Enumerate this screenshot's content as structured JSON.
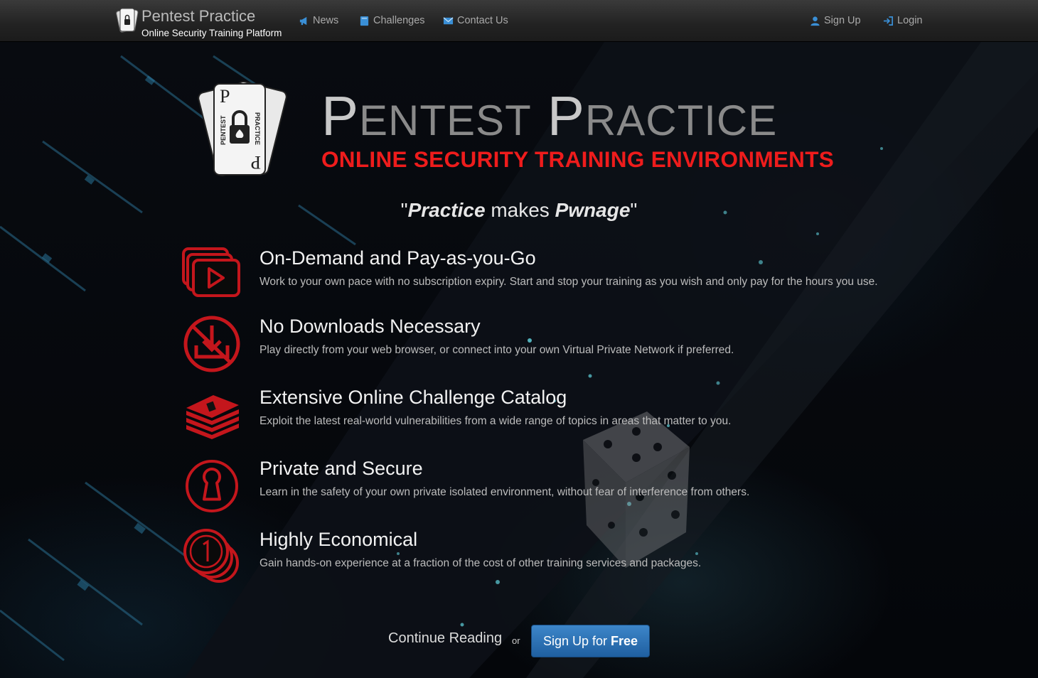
{
  "navbar": {
    "brand_title": "Pentest Practice",
    "brand_subtitle": "Online Security Training Platform",
    "links": [
      {
        "label": "News",
        "icon": "megaphone-icon"
      },
      {
        "label": "Challenges",
        "icon": "book-icon"
      },
      {
        "label": "Contact Us",
        "icon": "envelope-icon"
      }
    ],
    "right_links": [
      {
        "label": "Sign Up",
        "icon": "user-icon"
      },
      {
        "label": "Login",
        "icon": "login-icon"
      }
    ]
  },
  "hero": {
    "title_word1_cap": "P",
    "title_word1_rest": "ENTEST",
    "title_word2_cap": "P",
    "title_word2_rest": "RACTICE",
    "subtitle": "ONLINE SECURITY TRAINING ENVIRONMENTS",
    "logo_text_left": "PENTEST",
    "logo_text_right": "PRACTICE",
    "tagline_open": "\"",
    "tagline_word1": "Practice",
    "tagline_mid": " makes ",
    "tagline_word2": "Pwnage",
    "tagline_close": "\""
  },
  "features": [
    {
      "title": "On-Demand and Pay-as-you-Go",
      "desc": "Work to your own pace with no subscription expiry. Start and stop your training as you wish and only pay for the hours you use.",
      "icon": "video-stack-icon"
    },
    {
      "title": "No Downloads Necessary",
      "desc": "Play directly from your web browser, or connect into your own Virtual Private Network if preferred.",
      "icon": "no-download-icon"
    },
    {
      "title": "Extensive Online Challenge Catalog",
      "desc": "Exploit the latest real-world vulnerabilities from a wide range of topics in areas that matter to you.",
      "icon": "book-stack-icon"
    },
    {
      "title": "Private and Secure",
      "desc": "Learn in the safety of your own private isolated environment, without fear of interference from others.",
      "icon": "keyhole-icon"
    },
    {
      "title": "Highly Economical",
      "desc": "Gain hands-on experience at a fraction of the cost of other training services and packages.",
      "icon": "coins-icon"
    }
  ],
  "cta": {
    "continue_label": "Continue Reading",
    "or_label": "or",
    "signup_label_light": "Sign Up for",
    "signup_label_bold": "Free"
  },
  "colors": {
    "accent_red": "#ee1c1c",
    "icon_red": "#c4161c",
    "button_blue": "#2a6db0",
    "nav_link": "#a9a9a9",
    "nav_icon_blue": "#3a8fd6"
  }
}
